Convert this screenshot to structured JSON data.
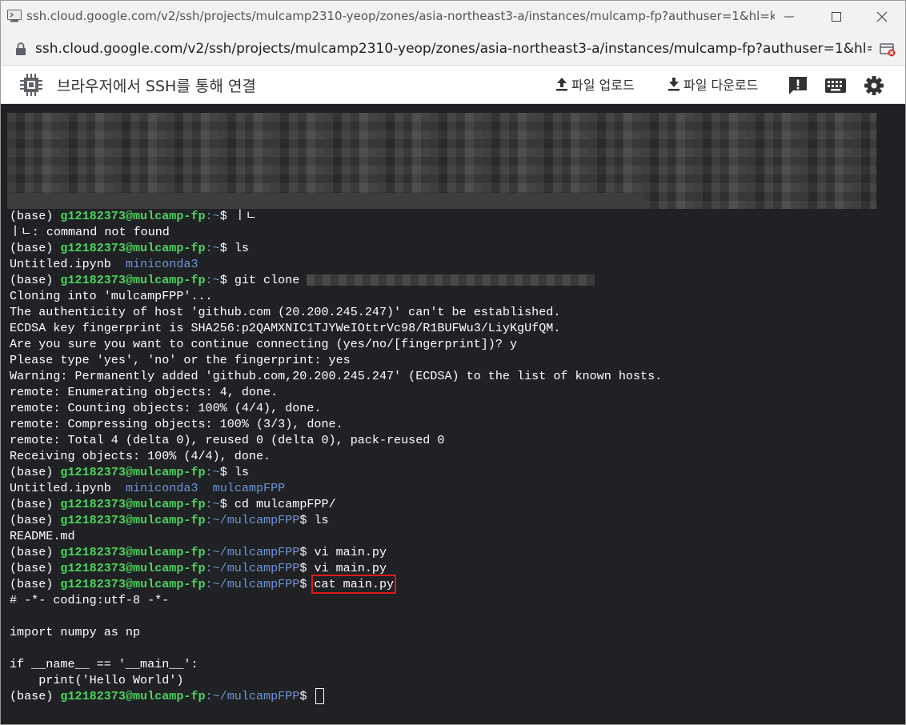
{
  "window": {
    "title": "ssh.cloud.google.com/v2/ssh/projects/mulcamp2310-yeop/zones/asia-northeast3-a/instances/mulcamp-fp?authuser=1&hl=ko&projec..."
  },
  "address_bar": {
    "url": "ssh.cloud.google.com/v2/ssh/projects/mulcamp2310-yeop/zones/asia-northeast3-a/instances/mulcamp-fp?authuser=1&hl=ko&p..."
  },
  "toolbar": {
    "title": "브라우저에서 SSH를 통해 연결",
    "upload_label": "파일 업로드",
    "download_label": "파일 다운로드",
    "icons": [
      "feedback-icon",
      "keyboard-icon",
      "settings-icon"
    ]
  },
  "terminal": {
    "prompt": {
      "env": "(base) ",
      "user_host": "g12182373@mulcamp-fp",
      "home": ":~",
      "project": ":~/mulcampFPP",
      "symbol": "$ "
    },
    "lines": [
      {
        "type": "prompt",
        "dir": "home",
        "cmd": "ㅣㄴ"
      },
      {
        "type": "out",
        "text": "ㅣㄴ: command not found"
      },
      {
        "type": "prompt",
        "dir": "home",
        "cmd": "ls"
      },
      {
        "type": "ls",
        "items": [
          {
            "text": "Untitled.ipynb",
            "kind": "file"
          },
          {
            "text": "miniconda3",
            "kind": "dir"
          }
        ]
      },
      {
        "type": "prompt",
        "dir": "home",
        "cmd": "git clone ",
        "redacted": true
      },
      {
        "type": "out",
        "text": "Cloning into 'mulcampFPP'..."
      },
      {
        "type": "out",
        "text": "The authenticity of host 'github.com (20.200.245.247)' can't be established."
      },
      {
        "type": "out",
        "text": "ECDSA key fingerprint is SHA256:p2QAMXNIC1TJYWeIOttrVc98/R1BUFWu3/LiyKgUfQM."
      },
      {
        "type": "out",
        "text": "Are you sure you want to continue connecting (yes/no/[fingerprint])? y"
      },
      {
        "type": "out",
        "text": "Please type 'yes', 'no' or the fingerprint: yes"
      },
      {
        "type": "out",
        "text": "Warning: Permanently added 'github.com,20.200.245.247' (ECDSA) to the list of known hosts."
      },
      {
        "type": "out",
        "text": "remote: Enumerating objects: 4, done."
      },
      {
        "type": "out",
        "text": "remote: Counting objects: 100% (4/4), done."
      },
      {
        "type": "out",
        "text": "remote: Compressing objects: 100% (3/3), done."
      },
      {
        "type": "out",
        "text": "remote: Total 4 (delta 0), reused 0 (delta 0), pack-reused 0"
      },
      {
        "type": "out",
        "text": "Receiving objects: 100% (4/4), done."
      },
      {
        "type": "prompt",
        "dir": "home",
        "cmd": "ls"
      },
      {
        "type": "ls",
        "items": [
          {
            "text": "Untitled.ipynb",
            "kind": "file"
          },
          {
            "text": "miniconda3",
            "kind": "dir"
          },
          {
            "text": "mulcampFPP",
            "kind": "dir"
          }
        ]
      },
      {
        "type": "prompt",
        "dir": "home",
        "cmd": "cd mulcampFPP/"
      },
      {
        "type": "prompt",
        "dir": "project",
        "cmd": "ls"
      },
      {
        "type": "out",
        "text": "README.md"
      },
      {
        "type": "prompt",
        "dir": "project",
        "cmd": "vi main.py"
      },
      {
        "type": "prompt",
        "dir": "project",
        "cmd": "vi main.py"
      },
      {
        "type": "prompt",
        "dir": "project",
        "cmd": "cat main.py",
        "highlight": true
      },
      {
        "type": "out",
        "text": "# -*- coding:utf-8 -*-"
      },
      {
        "type": "out",
        "text": ""
      },
      {
        "type": "out",
        "text": "import numpy as np"
      },
      {
        "type": "out",
        "text": ""
      },
      {
        "type": "out",
        "text": "if __name__ == '__main__':"
      },
      {
        "type": "out",
        "text": "    print('Hello World')"
      },
      {
        "type": "prompt",
        "dir": "project",
        "cmd": "",
        "cursor": true
      }
    ]
  },
  "colors": {
    "terminal_bg": "#202124",
    "user_host": "#4ad45e",
    "path": "#6f94d8",
    "highlight_box": "#e0191b"
  }
}
